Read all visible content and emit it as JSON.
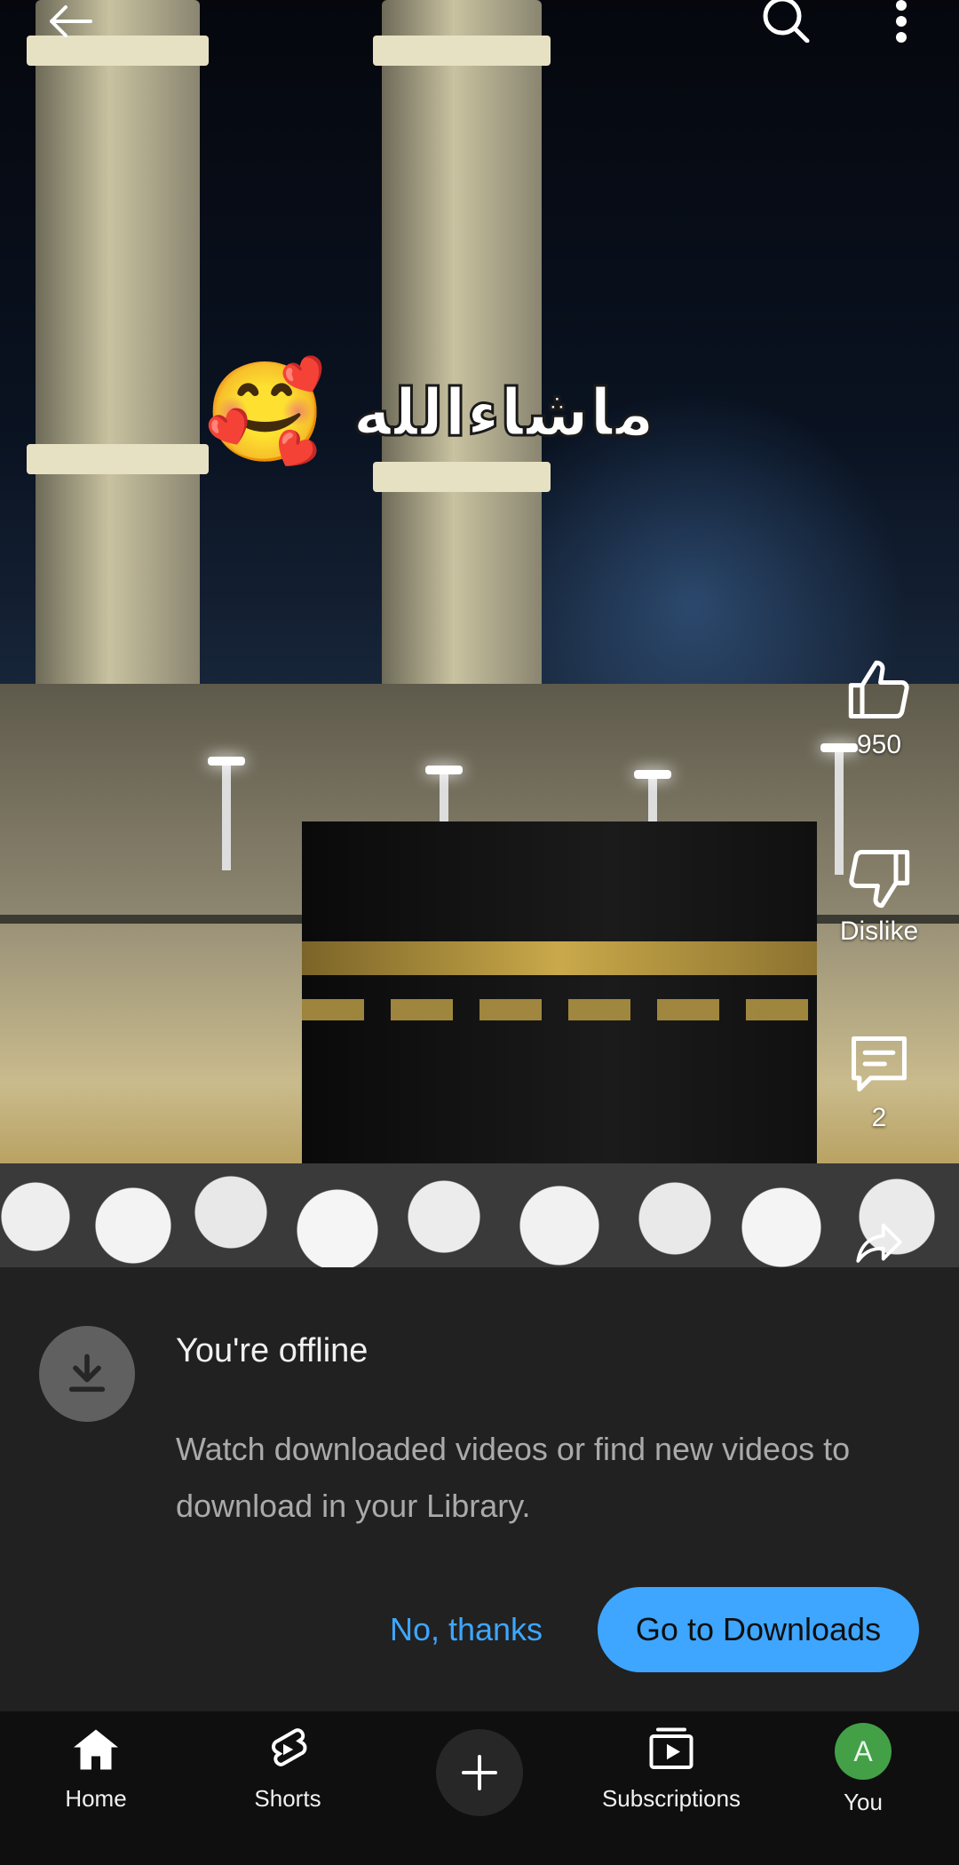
{
  "video": {
    "overlay_emoji": "🥰",
    "overlay_text": "ماشاءالله"
  },
  "top_bar": {
    "back_icon": "arrow-left-icon",
    "search_icon": "search-icon",
    "more_icon": "more-vertical-icon"
  },
  "actions": {
    "like_count": "950",
    "dislike_label": "Dislike",
    "comments_count": "2"
  },
  "offline_sheet": {
    "title": "You're offline",
    "message": "Watch downloaded videos or find new videos to download in your Library.",
    "dismiss_label": "No, thanks",
    "primary_label": "Go to Downloads",
    "accent_color": "#3ea6ff"
  },
  "bottom_nav": {
    "home": "Home",
    "shorts": "Shorts",
    "subscriptions": "Subscriptions",
    "you": "You",
    "avatar_letter": "A",
    "avatar_color": "#43a047"
  }
}
